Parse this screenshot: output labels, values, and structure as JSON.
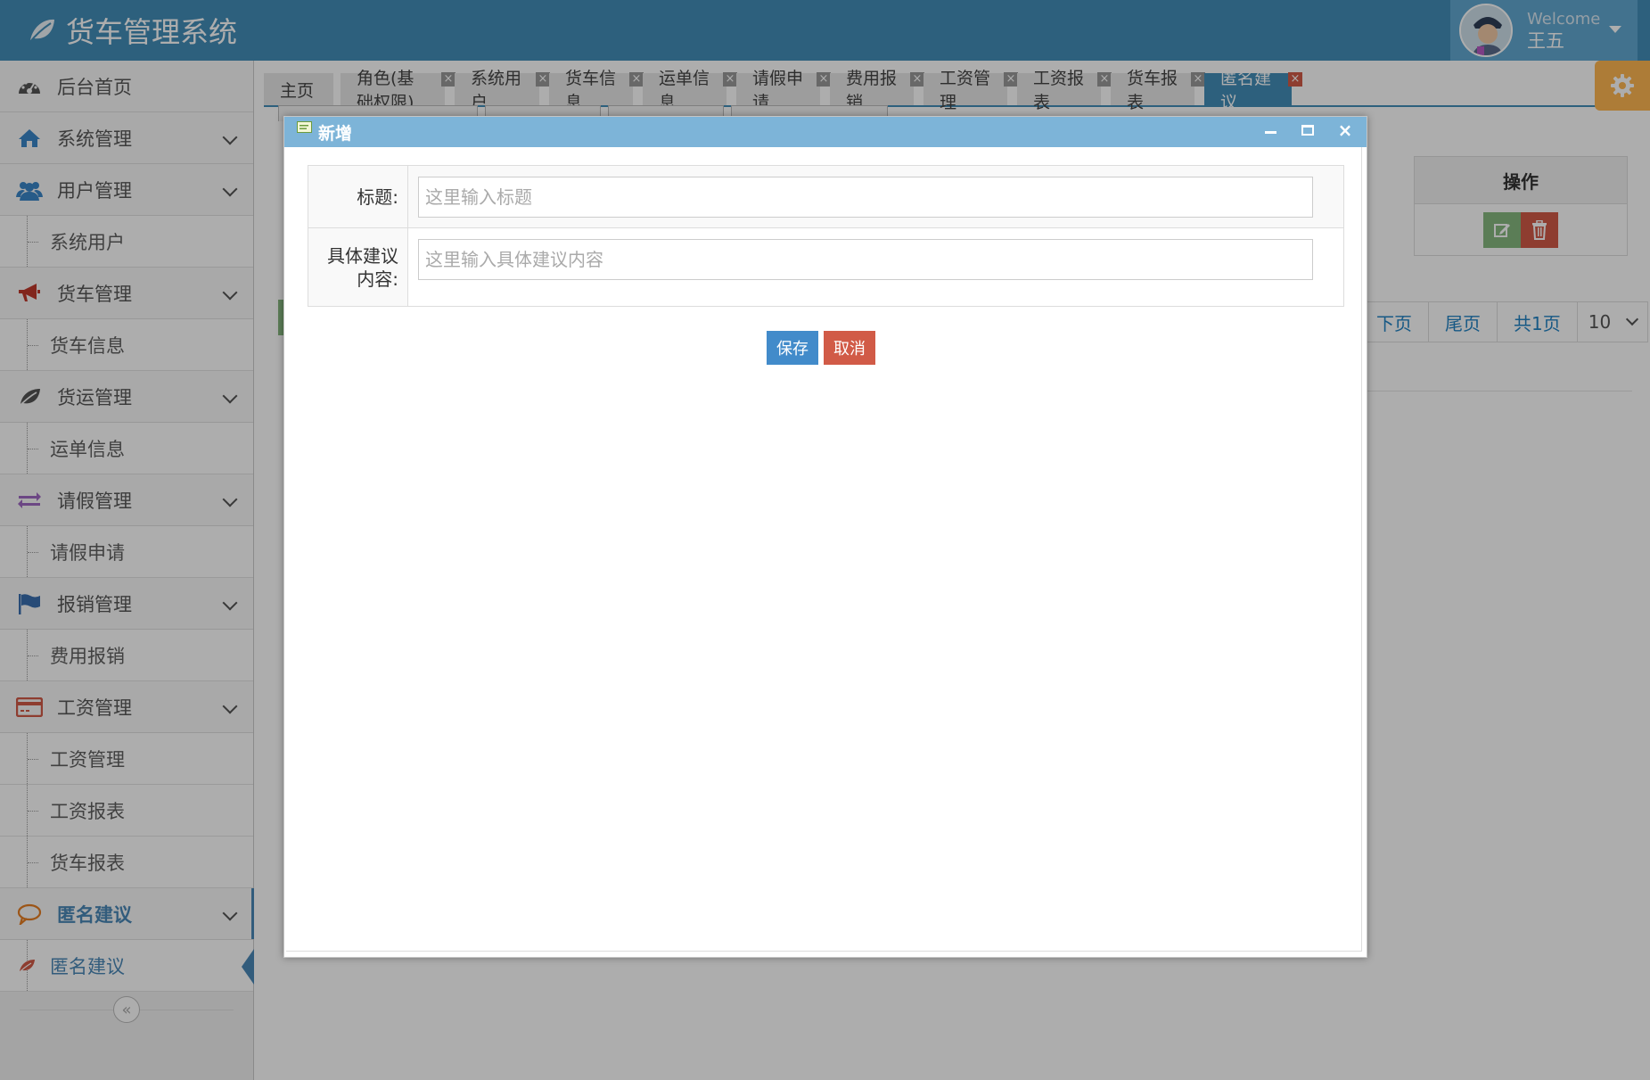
{
  "header": {
    "brand": "货车管理系统",
    "welcome": "Welcome",
    "username": "王五"
  },
  "sidebar": {
    "items": [
      {
        "type": "top",
        "label": "后台首页",
        "icon": "dashboard-icon"
      },
      {
        "type": "group",
        "label": "系统管理",
        "icon": "home-icon"
      },
      {
        "type": "group",
        "label": "用户管理",
        "icon": "users-icon"
      },
      {
        "type": "sub",
        "label": "系统用户"
      },
      {
        "type": "group",
        "label": "货车管理",
        "icon": "bullhorn-icon"
      },
      {
        "type": "sub",
        "label": "货车信息"
      },
      {
        "type": "group",
        "label": "货运管理",
        "icon": "leaf-icon"
      },
      {
        "type": "sub",
        "label": "运单信息"
      },
      {
        "type": "group",
        "label": "请假管理",
        "icon": "exchange-icon"
      },
      {
        "type": "sub",
        "label": "请假申请"
      },
      {
        "type": "group",
        "label": "报销管理",
        "icon": "flag-icon"
      },
      {
        "type": "sub",
        "label": "费用报销"
      },
      {
        "type": "group",
        "label": "工资管理",
        "icon": "credit-card-icon"
      },
      {
        "type": "sub",
        "label": "工资管理"
      },
      {
        "type": "sub",
        "label": "工资报表"
      },
      {
        "type": "sub",
        "label": "货车报表"
      },
      {
        "type": "group",
        "label": "匿名建议",
        "icon": "comment-icon",
        "active": true
      },
      {
        "type": "sub",
        "label": "匿名建议",
        "active": true
      }
    ],
    "collapse_glyph": "«"
  },
  "tabs": [
    {
      "label": "主页",
      "closable": false
    },
    {
      "label": "角色(基础权限)",
      "closable": true
    },
    {
      "label": "系统用户",
      "closable": true
    },
    {
      "label": "货车信息",
      "closable": true
    },
    {
      "label": "运单信息",
      "closable": true
    },
    {
      "label": "请假申请",
      "closable": true
    },
    {
      "label": "费用报销",
      "closable": true
    },
    {
      "label": "工资管理",
      "closable": true
    },
    {
      "label": "工资报表",
      "closable": true
    },
    {
      "label": "货车报表",
      "closable": true
    },
    {
      "label": "匿名建议",
      "closable": true,
      "active": true
    }
  ],
  "background": {
    "table_header_op": "操作",
    "pager": {
      "next": "下页",
      "last": "尾页",
      "total": "共1页",
      "page_size": "10"
    }
  },
  "dialog": {
    "title": "新增",
    "fields": [
      {
        "label": "标题:",
        "placeholder": "这里输入标题",
        "value": ""
      },
      {
        "label": "具体建议内容:",
        "placeholder": "这里输入具体建议内容",
        "value": ""
      }
    ],
    "save_label": "保存",
    "cancel_label": "取消",
    "close_glyph": "×"
  },
  "colors": {
    "brand_blue": "#438eb9",
    "active_blue": "#4b88b7",
    "danger": "#d15b47",
    "success": "#87b87f",
    "warning": "#ffb752",
    "dialog_title": "#7db4d8"
  }
}
